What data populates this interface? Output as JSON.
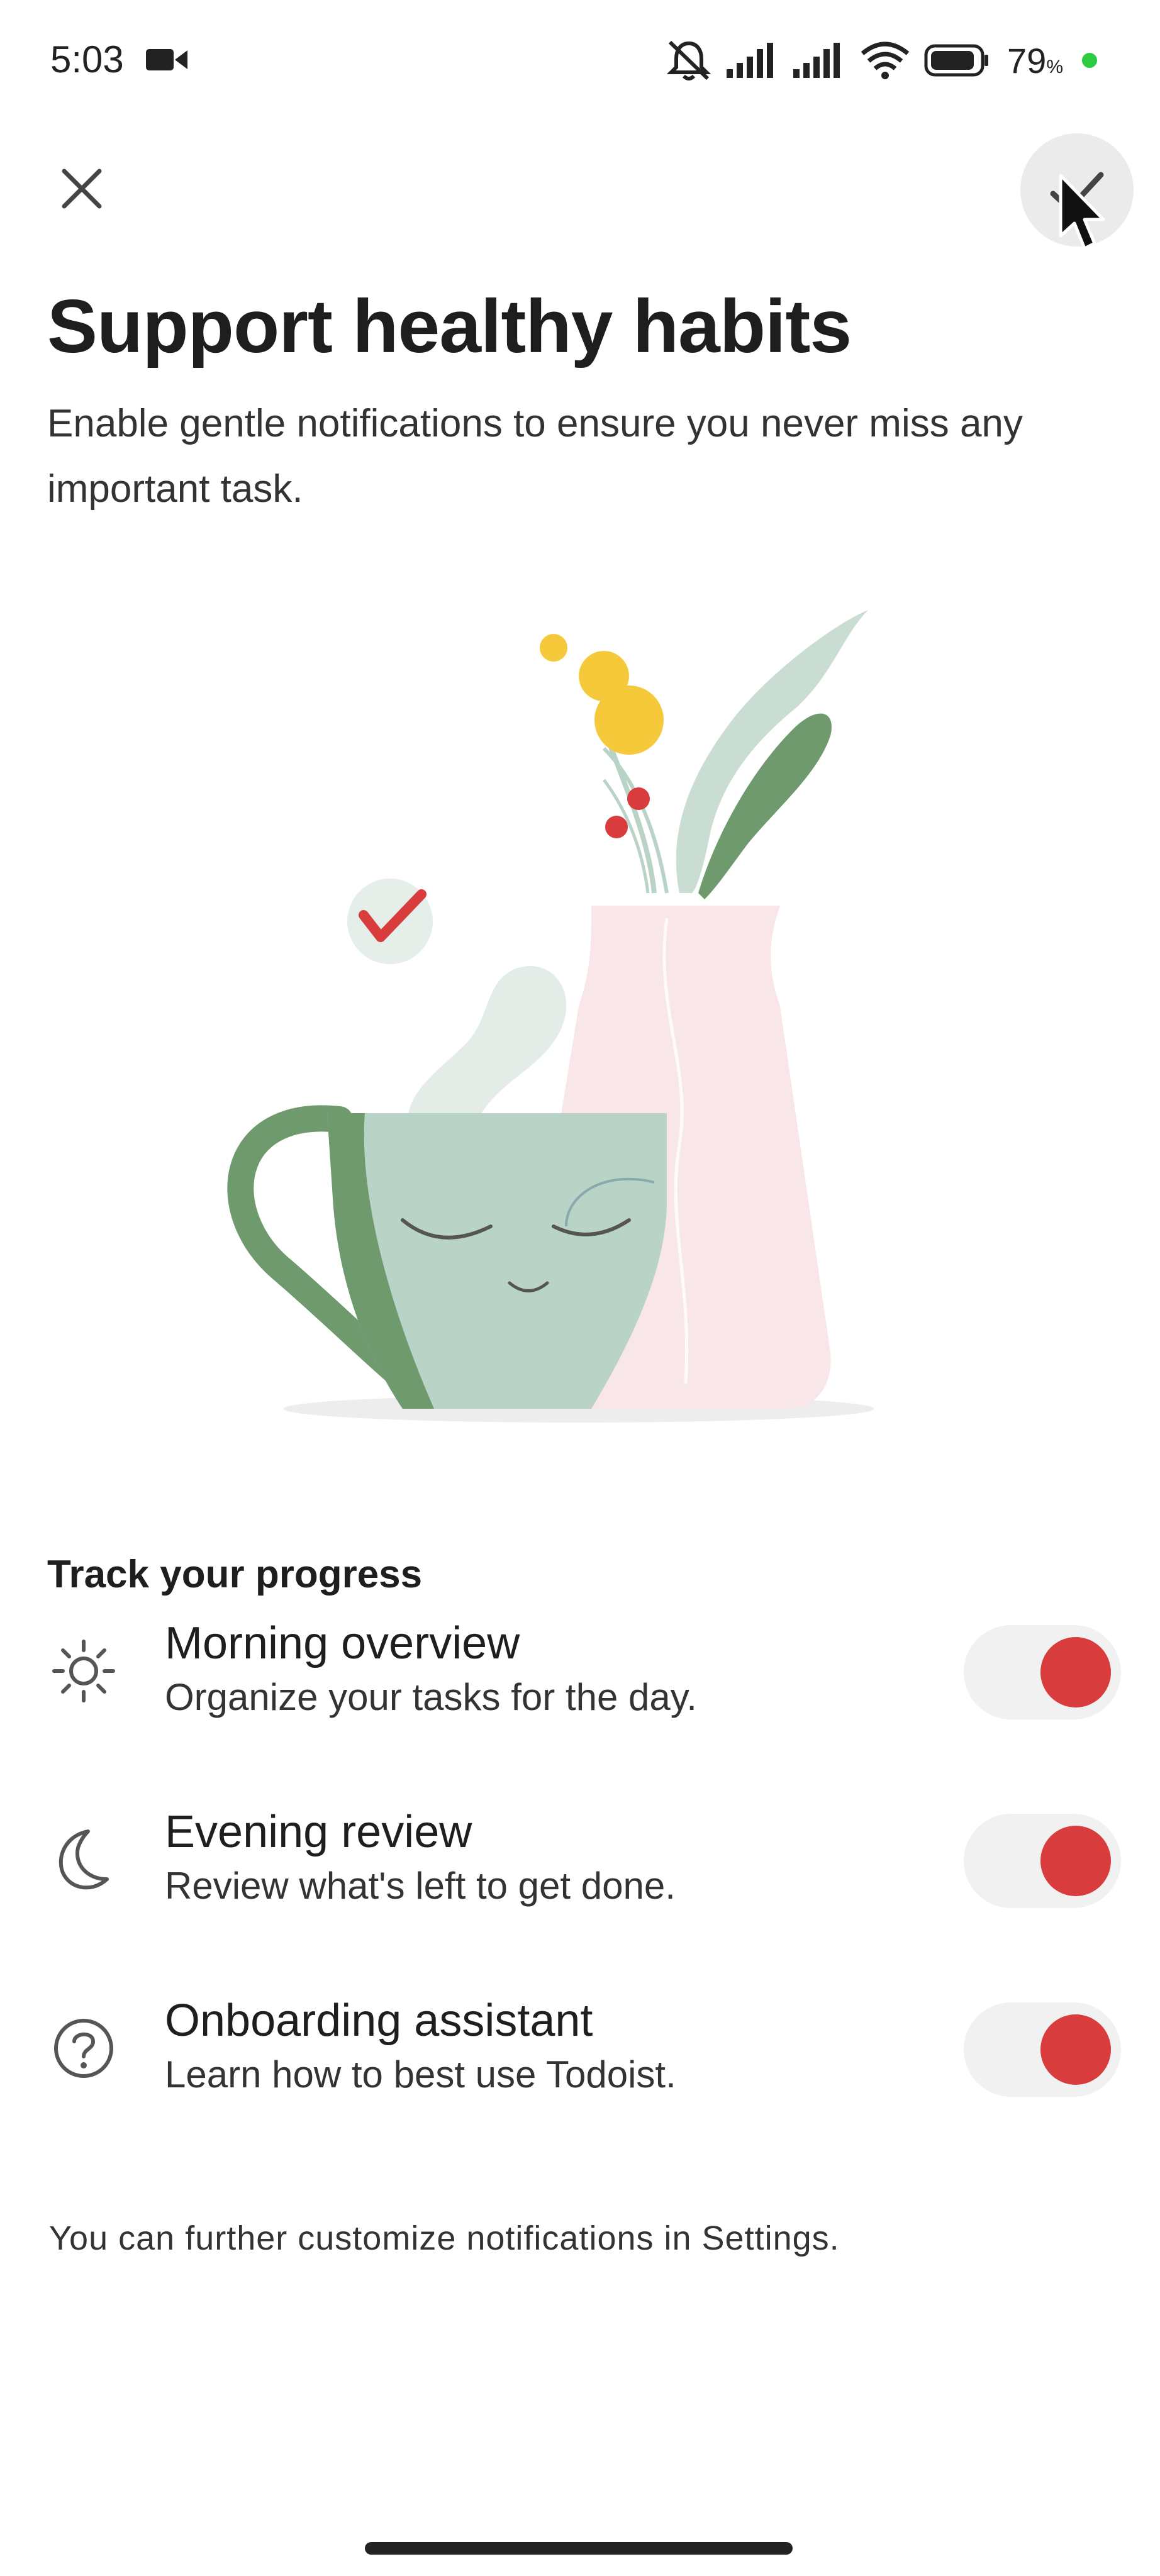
{
  "status_bar": {
    "time": "5:03",
    "battery_percent": "79",
    "battery_unit": "%",
    "icons": [
      "video-camera-icon",
      "muted-bell-icon",
      "signal-icon",
      "signal-icon",
      "wifi-icon",
      "battery-icon"
    ]
  },
  "header": {
    "close_icon": "close-icon",
    "confirm_icon": "checkmark-icon"
  },
  "title": "Support healthy habits",
  "subtitle": "Enable gentle notifications to ensure you never miss any important task.",
  "section": {
    "heading": "Track your progress",
    "items": [
      {
        "icon": "sun-icon",
        "title": "Morning overview",
        "description": "Organize your tasks for the day.",
        "enabled": true
      },
      {
        "icon": "moon-icon",
        "title": "Evening review",
        "description": "Review what's left to get done.",
        "enabled": true
      },
      {
        "icon": "help-circle-icon",
        "title": "Onboarding assistant",
        "description": "Learn how to best use Todoist.",
        "enabled": true
      }
    ]
  },
  "footer_note": "You can further customize notifications in Settings.",
  "colors": {
    "accent": "#d93c3c",
    "toggle_track": "#f1f1f1",
    "mug": "#b9d3c7",
    "mug_handle": "#6f9a6e",
    "vase": "#f8e6e8",
    "flower_yellow": "#f6c93b"
  }
}
